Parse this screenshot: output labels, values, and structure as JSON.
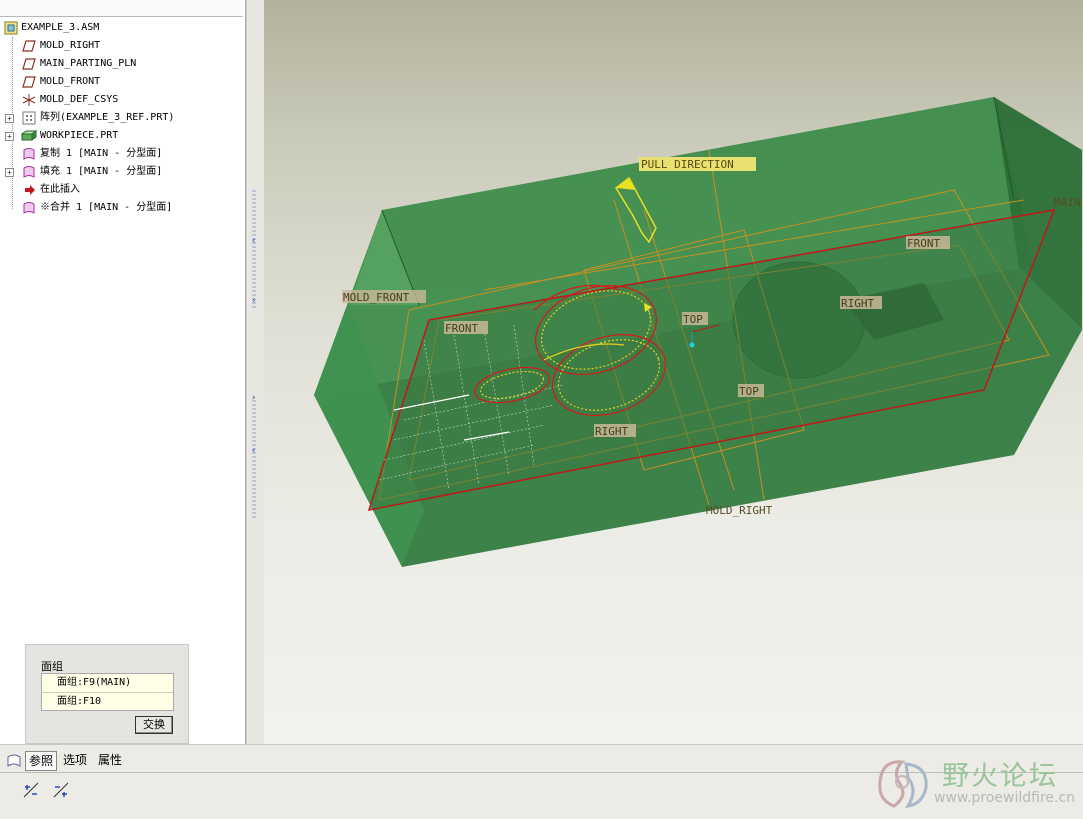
{
  "model_tree": {
    "items": [
      {
        "label": "EXAMPLE_3.ASM",
        "icon": "assembly-icon"
      },
      {
        "label": "MOLD_RIGHT",
        "icon": "datum-plane-icon"
      },
      {
        "label": "MAIN_PARTING_PLN",
        "icon": "datum-plane-icon"
      },
      {
        "label": "MOLD_FRONT",
        "icon": "datum-plane-icon"
      },
      {
        "label": "MOLD_DEF_CSYS",
        "icon": "csys-icon"
      },
      {
        "label": "阵列(EXAMPLE_3_REF.PRT)",
        "icon": "pattern-icon"
      },
      {
        "label": "WORKPIECE.PRT",
        "icon": "part-icon"
      },
      {
        "label": "复制 1 [MAIN - 分型面]",
        "icon": "surface-icon"
      },
      {
        "label": "填充 1 [MAIN - 分型面]",
        "icon": "surface-icon"
      },
      {
        "label": "在此插入",
        "icon": "insert-here-arrow-icon"
      },
      {
        "label": "※合并 1 [MAIN - 分型面]",
        "icon": "surface-icon"
      }
    ]
  },
  "viewport": {
    "labels": {
      "pull_direction": "PULL DIRECTION",
      "mold_front": "MOLD_FRONT",
      "front_1": "FRONT",
      "front_2": "FRONT",
      "right_1": "RIGHT",
      "right_2": "RIGHT",
      "top_1": "TOP",
      "top_2": "TOP",
      "mold_right": "MOLD_RIGHT",
      "main_cut": "MAIN"
    },
    "colors": {
      "workpiece": "#2f7a3c",
      "parting_edge": "#c01818",
      "datum": "#c89020",
      "label_bg": "#c8b898",
      "pull_label_bg": "#e8e070"
    }
  },
  "reference_popup": {
    "title": "面组",
    "items": [
      "面组:F9(MAIN)",
      "面组:F10"
    ],
    "swap_label": "交换"
  },
  "dashboard": {
    "tabs": [
      "参照",
      "选项",
      "属性"
    ]
  },
  "watermark": {
    "text": "野火论坛",
    "url": "www.proewildfire.cn"
  }
}
